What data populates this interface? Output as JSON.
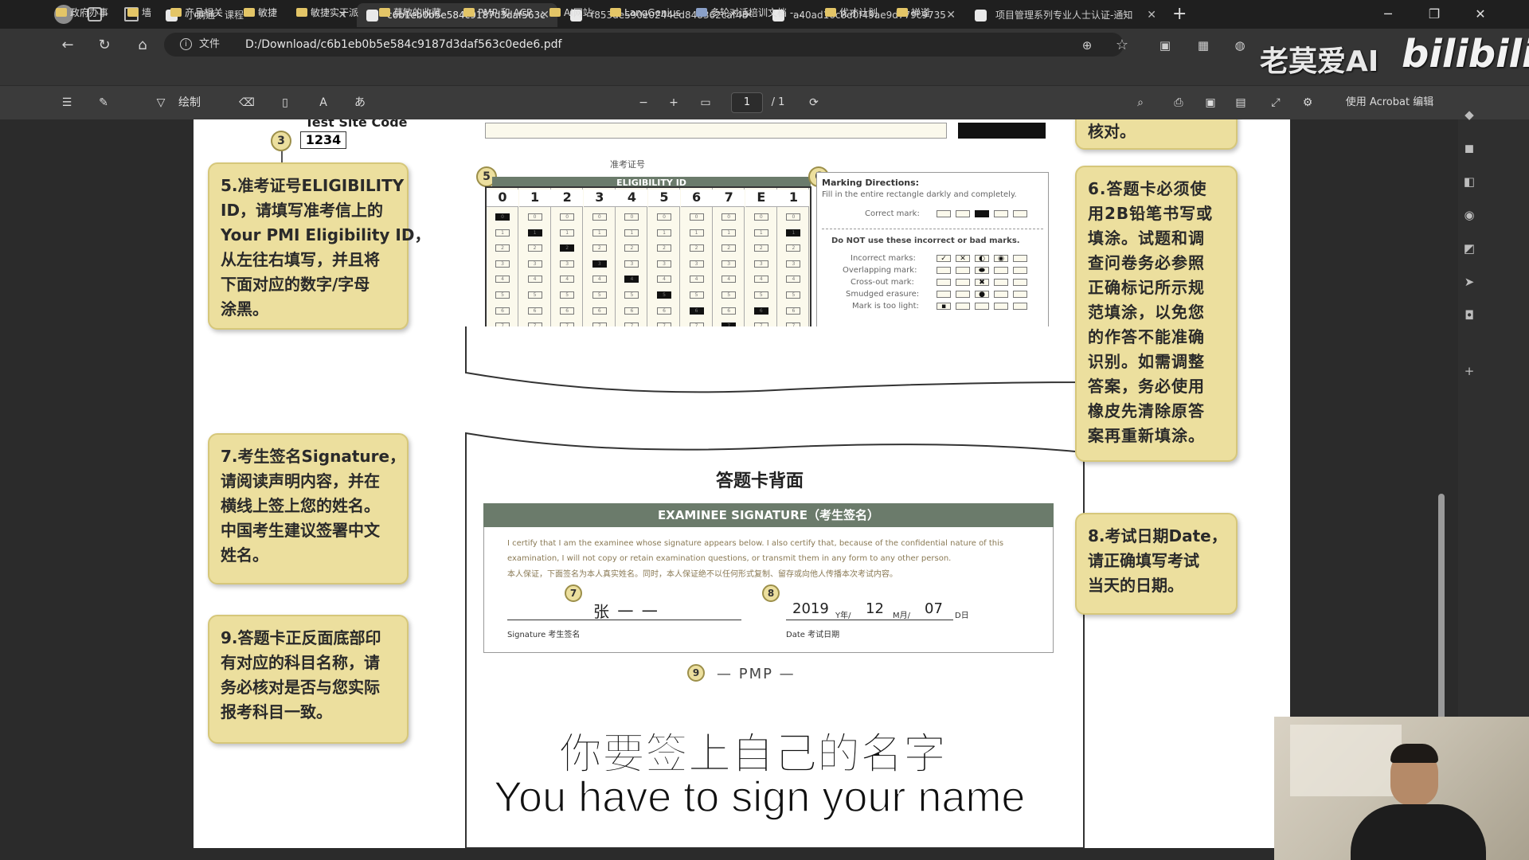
{
  "browser": {
    "tabs": [
      {
        "label": "小鹅通 - 课程"
      },
      {
        "label": "c6b1eb0b5e584c9187d3daf563c"
      },
      {
        "label": "f853de590e0244ed848362caf48"
      },
      {
        "label": "a40ad16c8d0f49ae9d779c9735"
      },
      {
        "label": "项目管理系列专业人士认证-通知"
      }
    ],
    "new_tab": "+",
    "address": {
      "info_label": "文件",
      "url": "D:/Download/c6b1eb0b5e584c9187d3daf563c0ede6.pdf"
    },
    "bookmarks": [
      "政府办事",
      "墙",
      "产品相关",
      "敏捷",
      "敏捷实干派",
      "莫敏的收藏",
      "PMP 和 ACP",
      "AI网站",
      "LangGenius",
      "多轮对话培训文档 -...",
      "优才计划",
      "禅道"
    ]
  },
  "pdf_toolbar": {
    "draw_label": "绘制",
    "page_current": "1",
    "page_total": "/ 1",
    "acrobat_label": "使用 Acrobat 编辑"
  },
  "watermark": {
    "text": "老莫爱AI",
    "site": "bilibili"
  },
  "sheet": {
    "test_site_code_label": "Test Site Code",
    "test_site_code": "1234",
    "n3": "3",
    "n5": "5",
    "n6": "6",
    "n7": "7",
    "n8": "8",
    "n9": "9",
    "eligibility_cn": "准考证号",
    "eligibility_header": "ELIGIBILITY ID",
    "eligibility_digits": [
      "0",
      "1",
      "2",
      "3",
      "4",
      "5",
      "6",
      "7",
      "E",
      "1"
    ],
    "marking": {
      "title": "Marking Directions:",
      "line1": "Fill in the entire rectangle darkly and completely.",
      "correct": "Correct mark:",
      "donot": "Do NOT use these incorrect or bad marks.",
      "rows": [
        "Incorrect marks:",
        "Overlapping mark:",
        "Cross-out mark:",
        "Smudged erasure:",
        "Mark is too light:"
      ]
    },
    "back_title": "答题卡背面",
    "signature_bar": "EXAMINEE SIGNATURE（考生签名）",
    "cert_en": "I certify that I am the examinee whose signature appears below. I also certify that, because of the confidential nature of this examination, I will not copy or retain examination questions, or transmit them in any form to any other person.",
    "cert_cn": "本人保证，下面签名为本人真实姓名。同时，本人保证绝不以任何形式复制、留存或向他人传播本次考试内容。",
    "signature_value": "张 一 一",
    "signature_label": "Signature 考生签名",
    "year": "2019",
    "year_unit": "Y年/",
    "month": "12",
    "month_unit": "M月/",
    "day": "07",
    "day_unit": "D日",
    "date_label": "Date 考试日期",
    "subject": "— PMP —",
    "top_right_partial": "核对。"
  },
  "callouts": {
    "c5": [
      "5.准考证号ELIGIBILITY",
      "ID，请填写准考信上的",
      "Your PMI Eligibility ID，",
      "从左往右填写，并且将",
      "下面对应的数字/字母",
      "涂黑。"
    ],
    "c6": [
      "6.答题卡必须使",
      "用2B铅笔书写或",
      "填涂。试题和调",
      "查问卷务必参照",
      "正确标记所示规",
      "范填涂，以免您",
      "的作答不能准确",
      "识别。如需调整",
      "答案，务必使用",
      "橡皮先清除原答",
      "案再重新填涂。"
    ],
    "c7": [
      "7.考生签名Signature，",
      "请阅读声明内容，并在",
      "横线上签上您的姓名。",
      "中国考生建议签署中文",
      "姓名。"
    ],
    "c8": [
      "8.考试日期Date，",
      "请正确填写考试",
      "当天的日期。"
    ],
    "c9": [
      "9.答题卡正反面底部印",
      "有对应的科目名称，请",
      "务必核对是否与您实际",
      "报考科目一致。"
    ]
  },
  "subtitle": {
    "cn": "你要签上自己的名字",
    "en": "You have to sign your name"
  },
  "colors": {
    "callout_bg": "#ecdf9e",
    "header_green": "#6b7b6b",
    "browser_dark": "#1f1f1f"
  }
}
